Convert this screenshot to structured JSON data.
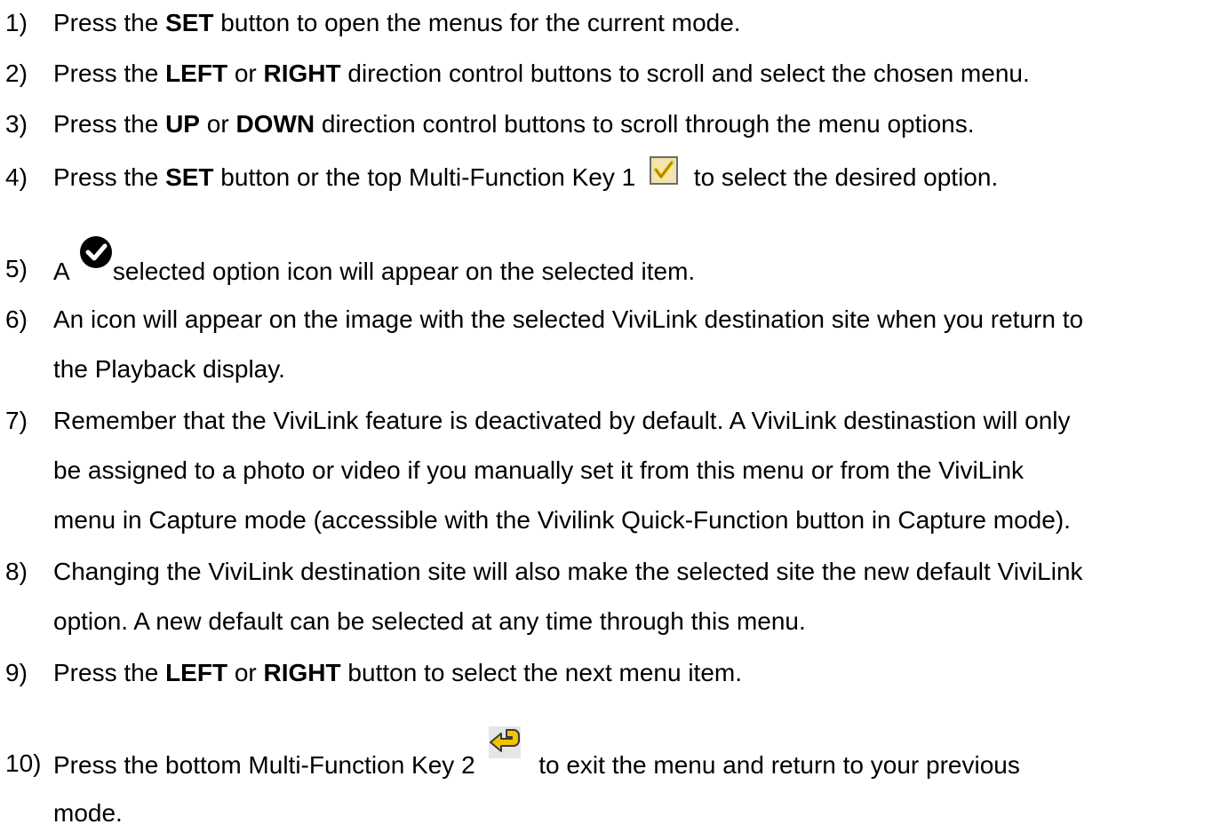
{
  "steps": [
    {
      "number": "1)",
      "text": {
        "a": "Press the ",
        "b": "SET",
        "c": " button to open the menus for the current mode."
      }
    },
    {
      "number": "2)",
      "text": {
        "a": "Press the ",
        "b": "LEFT",
        "c": " or ",
        "d": "RIGHT",
        "e": " direction control buttons to scroll and select the chosen menu."
      }
    },
    {
      "number": "3)",
      "text": {
        "a": "Press the ",
        "b": "UP",
        "c": " or ",
        "d": "DOWN",
        "e": " direction control buttons to scroll through the menu options."
      }
    },
    {
      "number": "4)",
      "text": {
        "a": "Press the ",
        "b": "SET",
        "c": " button or the top Multi-Function Key 1 ",
        "icon": "checkbox-checked-icon",
        "d": " to select the desired option."
      }
    },
    {
      "number": "5)",
      "text": {
        "a": "A ",
        "icon": "selected-check-circle-icon",
        "b": "selected option icon will appear on the selected item."
      }
    },
    {
      "number": "6)",
      "lines": [
        "An icon will appear on the image with the selected ViviLink destination site when you return to",
        "the Playback display."
      ]
    },
    {
      "number": "7)",
      "lines": [
        "Remember that the ViviLink feature is deactivated by default. A ViviLink destinastion will only",
        "be assigned to a photo or video if you manually set it from this menu or from the ViviLink",
        "menu in Capture mode (accessible with the Vivilink Quick-Function button in Capture mode)."
      ]
    },
    {
      "number": "8)",
      "lines": [
        "Changing the ViviLink destination site will also make the selected site the new default ViviLink",
        "option. A new default can be selected at any time through this menu."
      ]
    },
    {
      "number": "9)",
      "text": {
        "a": "Press the ",
        "b": "LEFT",
        "c": " or ",
        "d": "RIGHT",
        "e": " button to select the next menu item."
      }
    },
    {
      "number": "10)",
      "text": {
        "a": "Press the bottom Multi-Function Key 2 ",
        "icon": "return-arrow-icon",
        "b": " to exit the menu and return to your previous"
      },
      "continuation": "mode."
    }
  ],
  "colors": {
    "text": "#000000",
    "checkbox_fill": "#f5e7a8",
    "checkbox_check": "#e0b000",
    "return_icon_fill": "#f2c400",
    "circle_icon": "#000000"
  }
}
